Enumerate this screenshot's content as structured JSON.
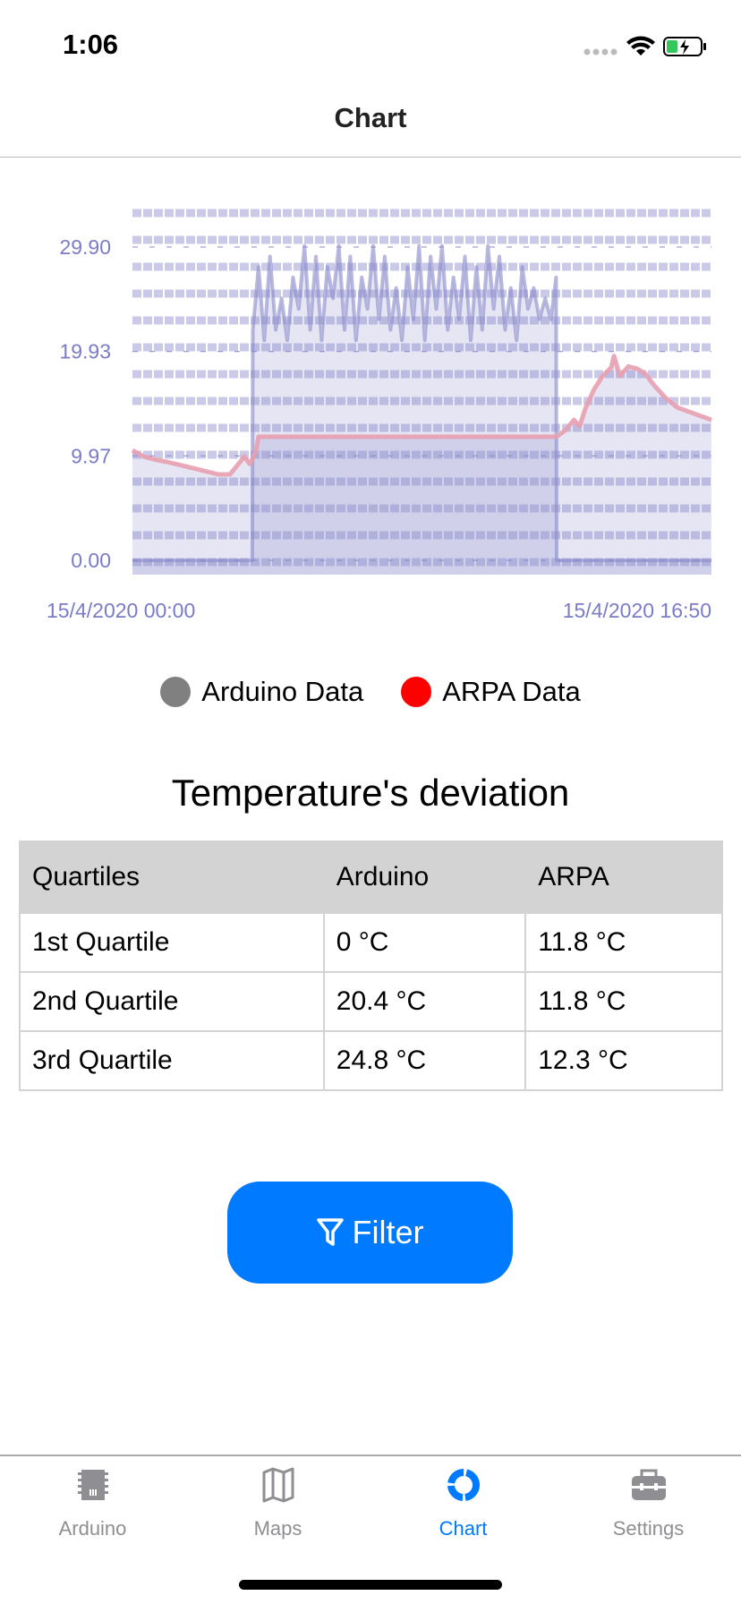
{
  "status_bar": {
    "time": "1:06",
    "icons": [
      "signal-dots-icon",
      "wifi-icon",
      "battery-charging-icon"
    ]
  },
  "nav": {
    "title": "Chart"
  },
  "colors": {
    "accent": "#007aff",
    "arduino": "#808080",
    "arpa": "#ff0000",
    "chart_fill": "#8a8acc",
    "axis_text": "#7b7bc8",
    "inactive": "#8e8e93"
  },
  "chart_data": {
    "type": "area",
    "ylim": [
      0,
      29.9
    ],
    "yticks": [
      "29.90",
      "19.93",
      "9.97",
      "0.00"
    ],
    "ytick_values": [
      29.9,
      19.93,
      9.97,
      0
    ],
    "xlim": [
      "00:00",
      "16:50"
    ],
    "xtick_labels": [
      "15/4/2020 00:00",
      "15/4/2020 16:50"
    ],
    "grid": true,
    "legend_placement": "bottom",
    "series": [
      {
        "name": "Arduino Data",
        "color": "#808080",
        "points": [
          [
            "00:00",
            0
          ],
          [
            "03:29",
            0
          ],
          [
            "03:30",
            22
          ],
          [
            "03:40",
            28
          ],
          [
            "03:50",
            21
          ],
          [
            "04:00",
            29
          ],
          [
            "04:10",
            22
          ],
          [
            "04:20",
            25
          ],
          [
            "04:30",
            21
          ],
          [
            "04:40",
            27
          ],
          [
            "04:50",
            24
          ],
          [
            "05:00",
            30
          ],
          [
            "05:10",
            22
          ],
          [
            "05:20",
            29
          ],
          [
            "05:30",
            21
          ],
          [
            "05:40",
            28
          ],
          [
            "05:50",
            25
          ],
          [
            "06:00",
            30
          ],
          [
            "06:10",
            22
          ],
          [
            "06:20",
            29
          ],
          [
            "06:30",
            21
          ],
          [
            "06:40",
            27
          ],
          [
            "06:50",
            24
          ],
          [
            "07:00",
            30
          ],
          [
            "07:10",
            23
          ],
          [
            "07:20",
            29
          ],
          [
            "07:30",
            22
          ],
          [
            "07:40",
            26
          ],
          [
            "07:50",
            21
          ],
          [
            "08:00",
            28
          ],
          [
            "08:10",
            23
          ],
          [
            "08:20",
            30
          ],
          [
            "08:30",
            21
          ],
          [
            "08:40",
            29
          ],
          [
            "08:50",
            24
          ],
          [
            "09:00",
            30
          ],
          [
            "09:10",
            22
          ],
          [
            "09:20",
            27
          ],
          [
            "09:30",
            23
          ],
          [
            "09:40",
            29
          ],
          [
            "09:50",
            21
          ],
          [
            "10:00",
            28
          ],
          [
            "10:10",
            22
          ],
          [
            "10:20",
            30
          ],
          [
            "10:30",
            24
          ],
          [
            "10:40",
            29
          ],
          [
            "10:50",
            22
          ],
          [
            "11:00",
            26
          ],
          [
            "11:10",
            21
          ],
          [
            "11:20",
            28
          ],
          [
            "11:30",
            24
          ],
          [
            "11:40",
            26
          ],
          [
            "11:50",
            23
          ],
          [
            "12:00",
            25
          ],
          [
            "12:10",
            23
          ],
          [
            "12:19",
            27
          ],
          [
            "12:20",
            0
          ],
          [
            "16:50",
            0
          ]
        ]
      },
      {
        "name": "ARPA Data",
        "color": "#ff0000",
        "points": [
          [
            "00:00",
            10.5
          ],
          [
            "00:20",
            9.9
          ],
          [
            "00:40",
            9.6
          ],
          [
            "01:00",
            9.4
          ],
          [
            "01:30",
            9.0
          ],
          [
            "02:00",
            8.6
          ],
          [
            "02:30",
            8.2
          ],
          [
            "02:50",
            8.2
          ],
          [
            "03:05",
            9.2
          ],
          [
            "03:15",
            9.9
          ],
          [
            "03:25",
            9.2
          ],
          [
            "03:35",
            10.4
          ],
          [
            "03:40",
            11.8
          ],
          [
            "12:20",
            11.8
          ],
          [
            "12:35",
            12.4
          ],
          [
            "12:50",
            13.4
          ],
          [
            "13:00",
            12.8
          ],
          [
            "13:10",
            14.5
          ],
          [
            "13:25",
            16.3
          ],
          [
            "13:40",
            17.6
          ],
          [
            "13:55",
            18.4
          ],
          [
            "14:00",
            19.5
          ],
          [
            "14:10",
            17.6
          ],
          [
            "14:25",
            18.5
          ],
          [
            "14:40",
            18.3
          ],
          [
            "14:55",
            17.8
          ],
          [
            "15:10",
            16.7
          ],
          [
            "15:30",
            15.5
          ],
          [
            "15:50",
            14.6
          ],
          [
            "16:10",
            14.2
          ],
          [
            "16:30",
            13.8
          ],
          [
            "16:50",
            13.4
          ]
        ]
      }
    ]
  },
  "legend": [
    {
      "label": "Arduino Data",
      "color": "#808080"
    },
    {
      "label": "ARPA Data",
      "color": "#ff0000"
    }
  ],
  "table": {
    "title": "Temperature's deviation",
    "headers": [
      "Quartiles",
      "Arduino",
      "ARPA"
    ],
    "rows": [
      [
        "1st Quartile",
        "0 °C",
        "11.8 °C"
      ],
      [
        "2nd Quartile",
        "20.4 °C",
        "11.8 °C"
      ],
      [
        "3rd Quartile",
        "24.8 °C",
        "12.3 °C"
      ]
    ]
  },
  "filter_button": {
    "label": "Filter",
    "icon": "filter-funnel-icon"
  },
  "tabs": [
    {
      "label": "Arduino",
      "icon": "chip-icon"
    },
    {
      "label": "Maps",
      "icon": "map-icon"
    },
    {
      "label": "Chart",
      "icon": "donut-chart-icon",
      "active": true
    },
    {
      "label": "Settings",
      "icon": "toolbox-icon"
    }
  ]
}
